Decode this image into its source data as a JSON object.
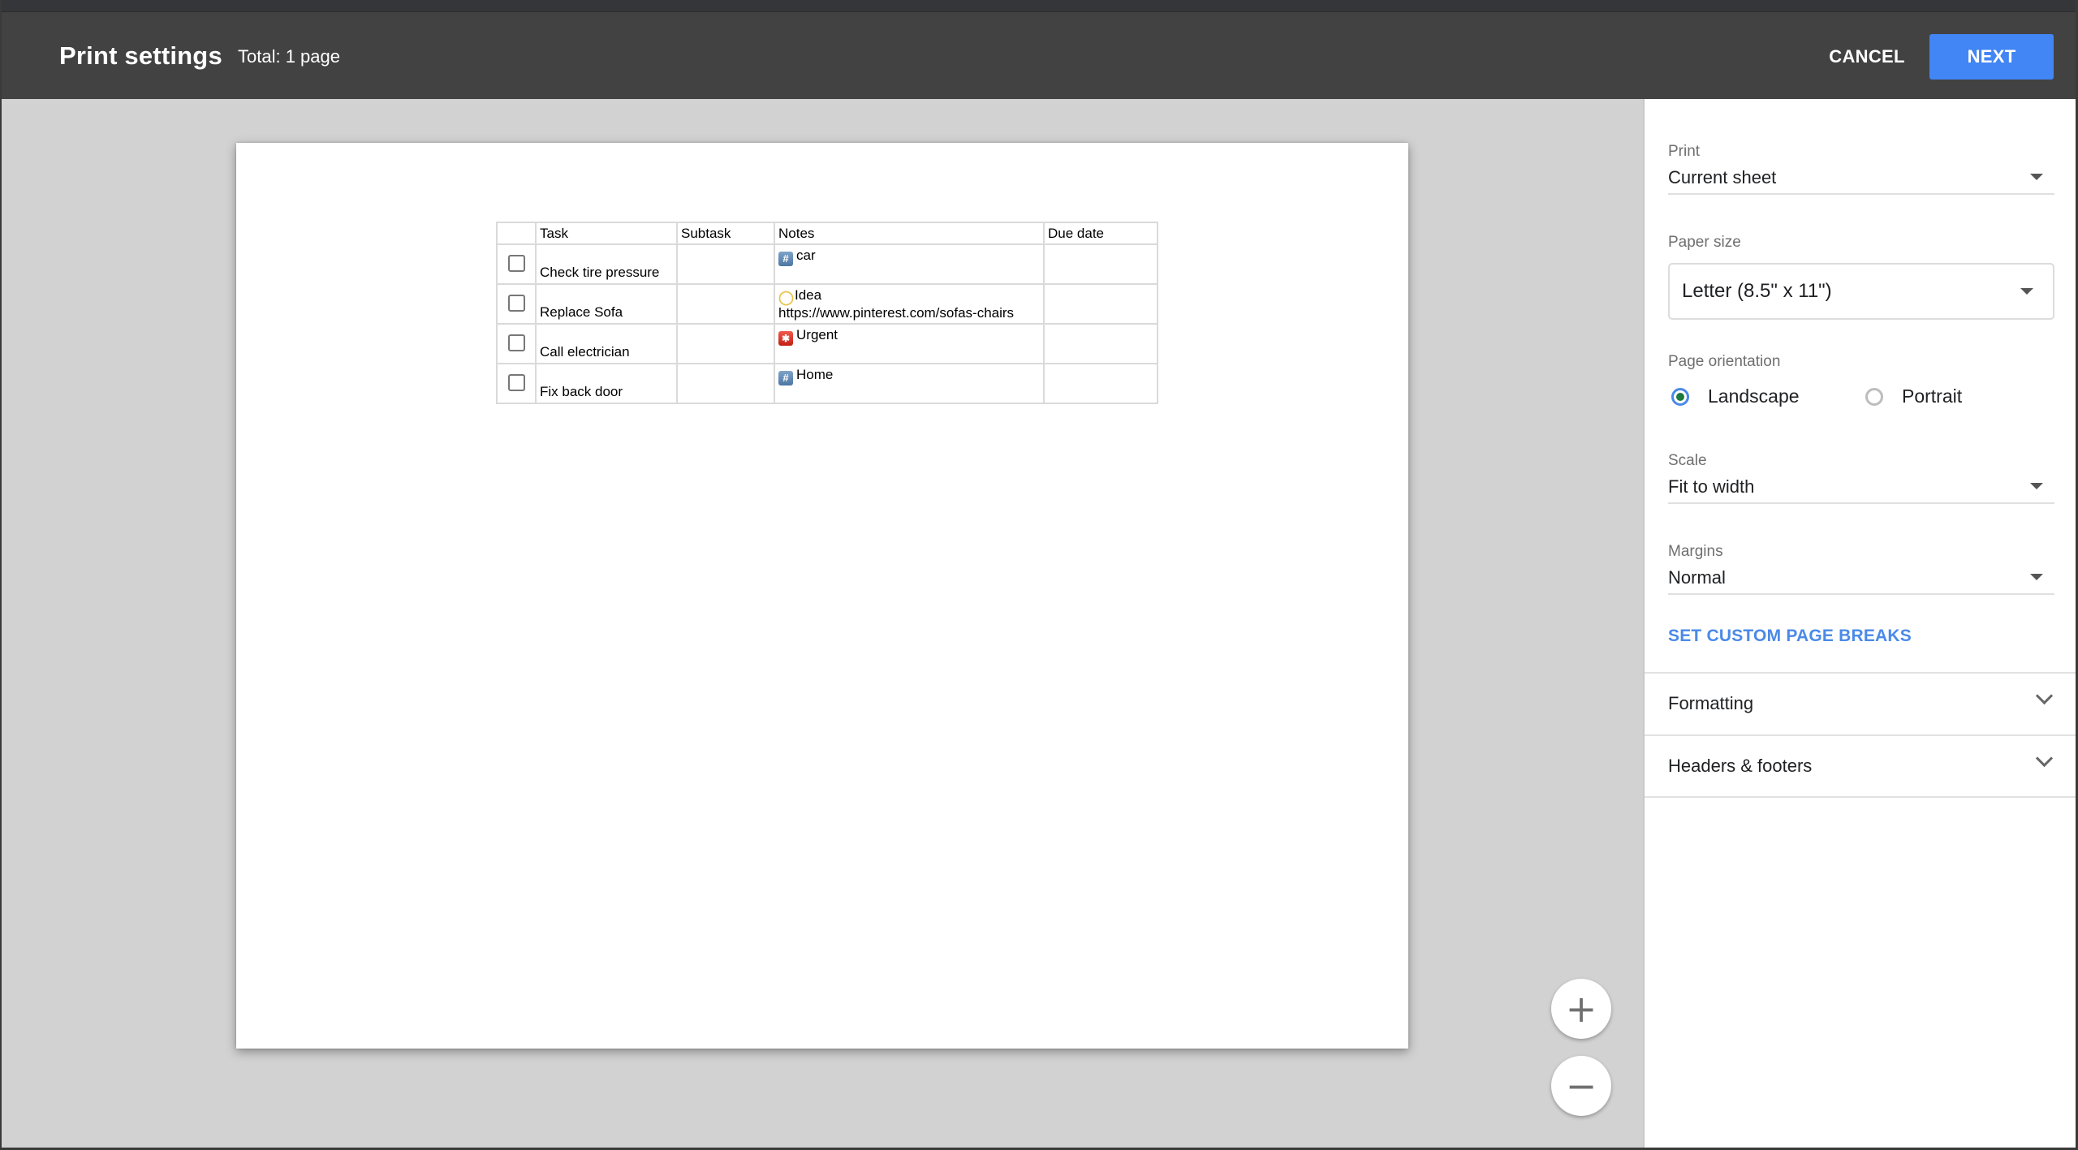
{
  "header": {
    "title": "Print settings",
    "total": "Total: 1 page",
    "cancel_label": "CANCEL",
    "next_label": "NEXT",
    "accent_color": "#4285f4"
  },
  "preview": {
    "table": {
      "columns": [
        "",
        "Task",
        "Subtask",
        "Notes",
        "Due date"
      ],
      "rows": [
        {
          "checked": false,
          "task": "Check tire pressure",
          "subtask": "",
          "note_icon": "keycap-hash-icon",
          "note_tag": "car",
          "note_extra": "",
          "due": ""
        },
        {
          "checked": false,
          "task": "Replace Sofa",
          "subtask": "",
          "note_icon": "light-bulb-icon",
          "note_tag": "Idea",
          "note_extra": "https://www.pinterest.com/sofas-chairs",
          "due": ""
        },
        {
          "checked": false,
          "task": "Call electrician",
          "subtask": "",
          "note_icon": "siren-icon",
          "note_tag": "Urgent",
          "note_extra": "",
          "due": ""
        },
        {
          "checked": false,
          "task": "Fix back door",
          "subtask": "",
          "note_icon": "keycap-hash-icon",
          "note_tag": "Home",
          "note_extra": "",
          "due": ""
        }
      ]
    },
    "zoom_in_icon": "plus-icon",
    "zoom_out_icon": "minus-icon"
  },
  "panel": {
    "print": {
      "label": "Print",
      "value": "Current sheet"
    },
    "paper_size": {
      "label": "Paper size",
      "value": "Letter (8.5\" x 11\")"
    },
    "orientation": {
      "label": "Page orientation",
      "options": [
        {
          "label": "Landscape",
          "checked": true
        },
        {
          "label": "Portrait",
          "checked": false
        }
      ]
    },
    "scale": {
      "label": "Scale",
      "value": "Fit to width"
    },
    "margins": {
      "label": "Margins",
      "value": "Normal"
    },
    "custom_breaks_label": "SET CUSTOM PAGE BREAKS",
    "sections": [
      {
        "title": "Formatting"
      },
      {
        "title": "Headers & footers"
      }
    ]
  }
}
